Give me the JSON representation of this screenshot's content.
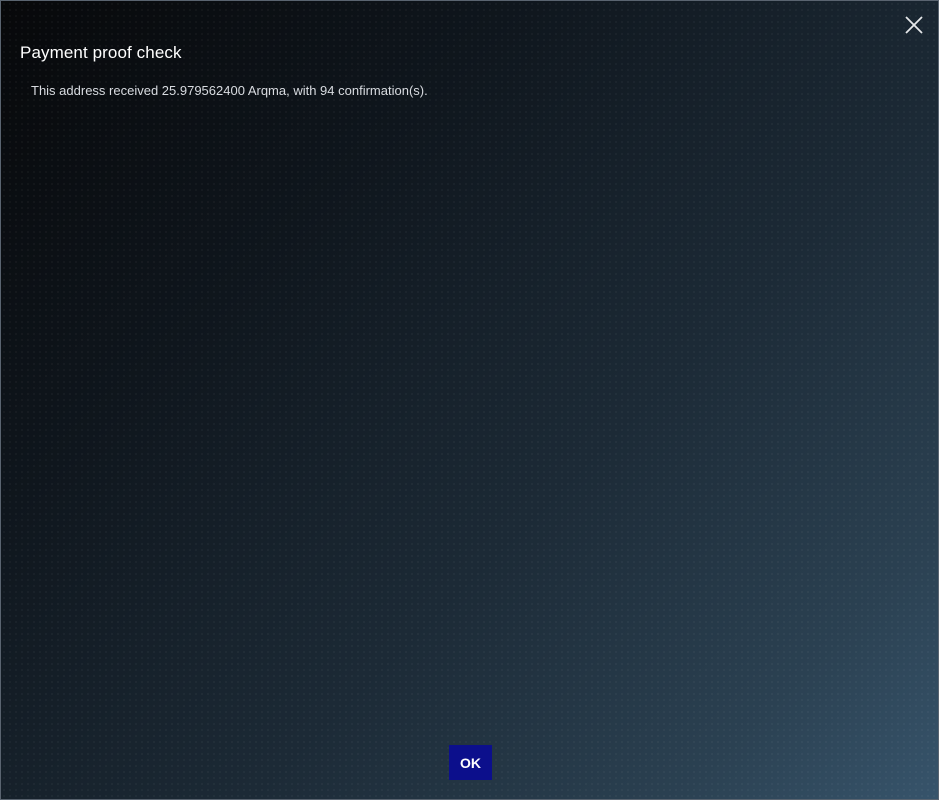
{
  "dialog": {
    "title": "Payment proof check",
    "message": "This address received 25.979562400 Arqma, with 94 confirmation(s).",
    "ok_label": "OK",
    "close_icon": "close-icon"
  },
  "colors": {
    "ok_button": "#0c0f8c",
    "title_text": "#ffffff",
    "message_text": "#d8dbe0"
  }
}
